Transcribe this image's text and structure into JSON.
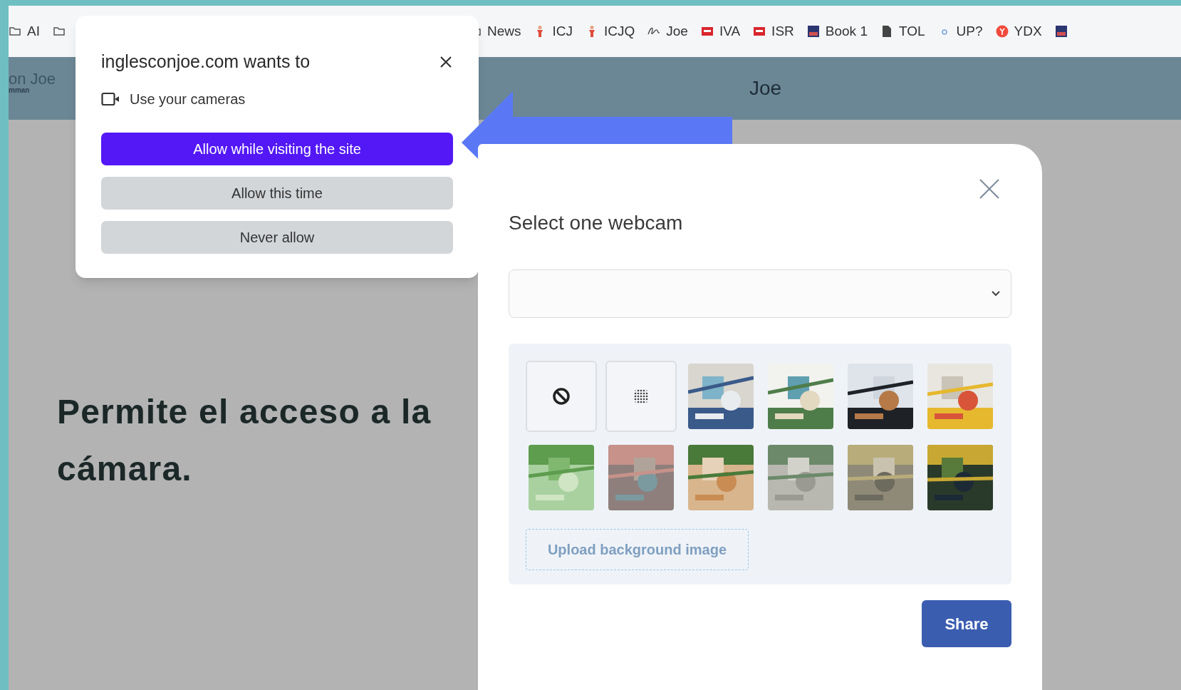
{
  "bookmarks": [
    {
      "kind": "folder",
      "label": "AI"
    },
    {
      "kind": "folder"
    },
    {
      "kind": "folder",
      "label": "News"
    },
    {
      "kind": "figure",
      "label": "ICJ"
    },
    {
      "kind": "figure",
      "label": "ICJQ"
    },
    {
      "kind": "script",
      "label": "Joe"
    },
    {
      "kind": "red",
      "label": "IVA"
    },
    {
      "kind": "red",
      "label": "ISR"
    },
    {
      "kind": "book",
      "label": "Book 1"
    },
    {
      "kind": "doc",
      "label": "TOL"
    },
    {
      "kind": "dot",
      "label": "UP?"
    },
    {
      "kind": "circle",
      "label": "YDX"
    },
    {
      "kind": "book"
    }
  ],
  "site_header": {
    "logo_text": "on Joe",
    "logo_subtext": "mman",
    "title": "Joe"
  },
  "permission_popup": {
    "title": "inglesconjoe.com wants to",
    "permission": "Use your cameras",
    "buttons": [
      {
        "label": "Allow while visiting the site",
        "kind": "primary"
      },
      {
        "label": "Allow this time",
        "kind": "secondary"
      },
      {
        "label": "Never allow",
        "kind": "secondary"
      }
    ]
  },
  "instruction": "Permite el acceso a la cámara.",
  "webcam_dialog": {
    "title": "Select one webcam",
    "backgrounds": [
      {
        "kind": "none"
      },
      {
        "kind": "blur"
      },
      {
        "kind": "picture"
      },
      {
        "kind": "picture"
      },
      {
        "kind": "picture"
      },
      {
        "kind": "picture"
      },
      {
        "kind": "picture"
      },
      {
        "kind": "picture"
      },
      {
        "kind": "picture"
      },
      {
        "kind": "picture"
      },
      {
        "kind": "picture"
      },
      {
        "kind": "picture"
      }
    ],
    "upload_button": "Upload background image",
    "share_button": "Share"
  }
}
